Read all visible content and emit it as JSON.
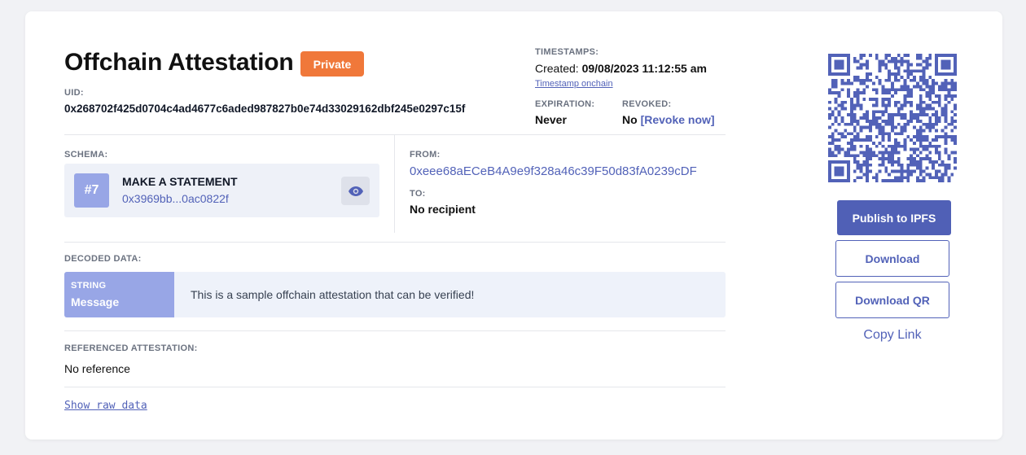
{
  "header": {
    "title": "Offchain Attestation",
    "badge": "Private",
    "uid_label": "UID:",
    "uid": "0x268702f425d0704c4ad4677c6aded987827b0e74d33029162dbf245e0297c15f"
  },
  "timestamps": {
    "label": "TIMESTAMPS:",
    "created_prefix": "Created:",
    "created_value": "09/08/2023 11:12:55 am",
    "onchain_link": "Timestamp onchain",
    "expiration_label": "EXPIRATION:",
    "expiration_value": "Never",
    "revoked_label": "REVOKED:",
    "revoked_value": "No",
    "revoke_link": "[Revoke now]"
  },
  "schema": {
    "label": "SCHEMA:",
    "number": "#7",
    "name": "MAKE A STATEMENT",
    "address": "0x3969bb...0ac0822f"
  },
  "parties": {
    "from_label": "FROM:",
    "from_value": "0xeee68aECeB4A9e9f328a46c39F50d83fA0239cDF",
    "to_label": "TO:",
    "to_value": "No recipient"
  },
  "decoded": {
    "label": "DECODED DATA:",
    "type": "STRING",
    "field_name": "Message",
    "field_value": "This is a sample offchain attestation that can be verified!"
  },
  "reference": {
    "label": "REFERENCED ATTESTATION:",
    "value": "No reference"
  },
  "raw_link": "Show raw data",
  "actions": {
    "publish": "Publish to IPFS",
    "download": "Download",
    "download_qr": "Download QR",
    "copy_link": "Copy Link"
  },
  "colors": {
    "accent": "#5262b8",
    "badge": "#f0783a",
    "chip": "#98a6e6"
  },
  "icons": {
    "eye": "eye-icon",
    "qr": "qr-code"
  }
}
